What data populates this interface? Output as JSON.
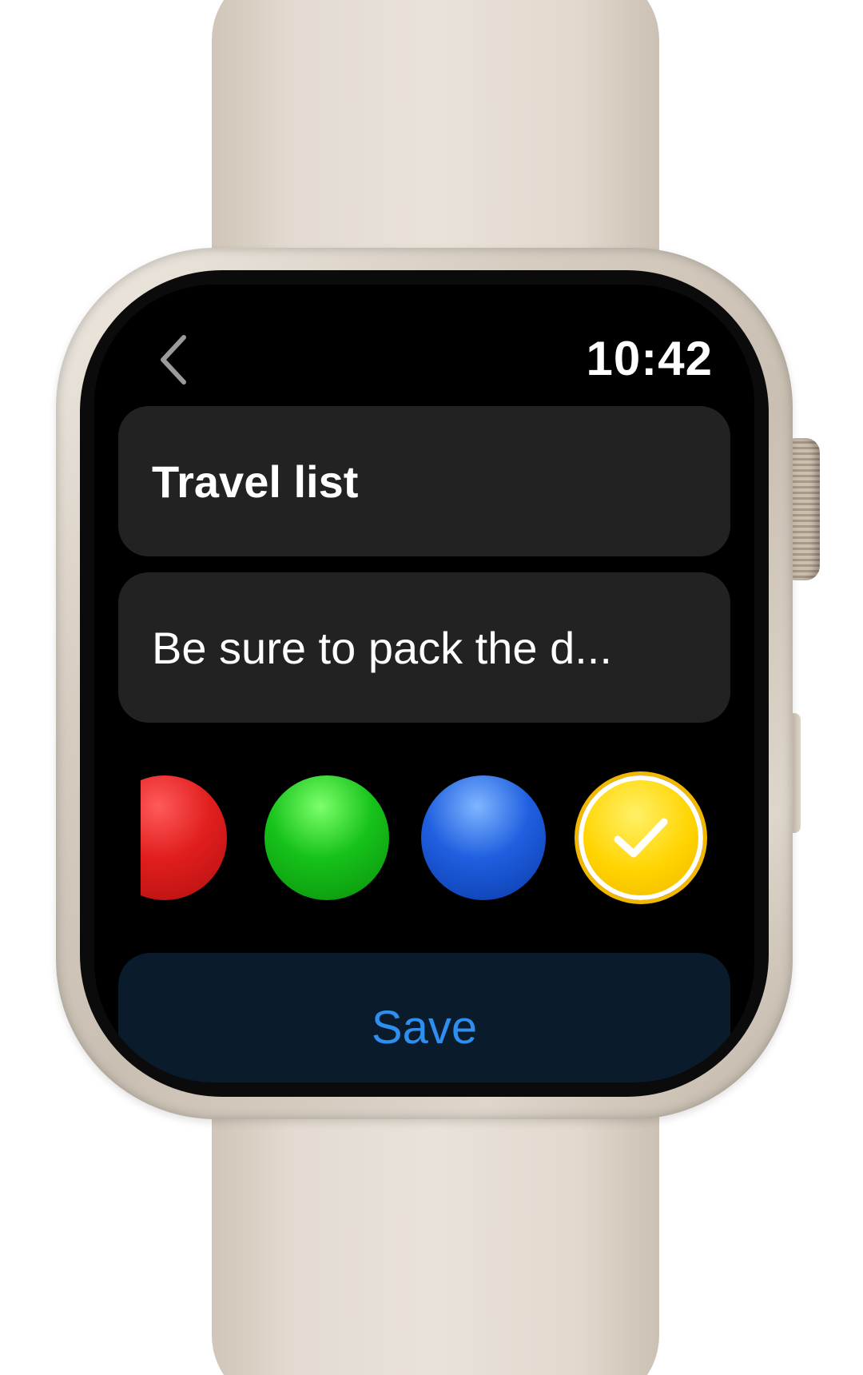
{
  "status_bar": {
    "time": "10:42"
  },
  "navigation": {
    "back_icon": "chevron-left-icon"
  },
  "form": {
    "title_value": "Travel list",
    "note_value": "Be sure to pack the d..."
  },
  "color_picker": {
    "options": [
      {
        "name": "red",
        "color": "#e11e1e",
        "selected": false
      },
      {
        "name": "green",
        "color": "#16c21a",
        "selected": false
      },
      {
        "name": "blue",
        "color": "#1f5fe0",
        "selected": false
      },
      {
        "name": "yellow",
        "color": "#ffd400",
        "selected": true
      }
    ],
    "selected_icon": "checkmark-icon"
  },
  "actions": {
    "save_label": "Save",
    "save_color": "#2e8ff0"
  }
}
